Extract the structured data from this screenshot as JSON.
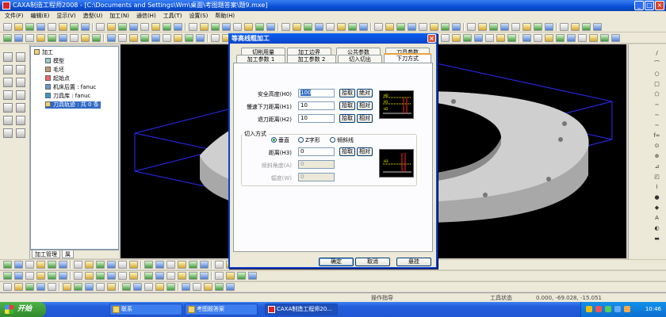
{
  "window": {
    "title": "CAXA制造工程师2008  - [C:\\Documents and Settings\\Wm\\桌面\\考图题答案\\题9.mxe]"
  },
  "menu": [
    "文件(F)",
    "编辑(E)",
    "显示(V)",
    "造型(U)",
    "加工(N)",
    "通信(H)",
    "工具(T)",
    "设置(S)",
    "帮助(H)"
  ],
  "tree": {
    "items": [
      {
        "label": "加工",
        "level": 0
      },
      {
        "label": "模型",
        "level": 1
      },
      {
        "label": "毛坯",
        "level": 1
      },
      {
        "label": "起始点",
        "level": 1
      },
      {
        "label": "机床后置 : fanuc",
        "level": 1
      },
      {
        "label": "刀具库 : fanuc",
        "level": 1
      },
      {
        "label": "刀具轨迹 : 共 0 条",
        "level": 1,
        "selected": true
      }
    ],
    "tabs": [
      "加工管理",
      "属"
    ]
  },
  "dialog": {
    "title": "等高线粗加工",
    "tabs_row1": [
      "切削用量",
      "加工边界",
      "公共参数",
      "刀具参数"
    ],
    "tabs_row2": [
      "加工参数 1",
      "加工参数 2",
      "切入切出",
      "下刀方式"
    ],
    "active_tab": "下刀方式",
    "fields": [
      {
        "label": "安全高度(H0)",
        "value": "100",
        "pick": "拾取",
        "mode": "绝对"
      },
      {
        "label": "慢速下刀距离(H1)",
        "value": "10",
        "pick": "拾取",
        "mode": "相对"
      },
      {
        "label": "退刀距离(H2)",
        "value": "10",
        "pick": "拾取",
        "mode": "相对"
      }
    ],
    "group_title": "切入方式",
    "radios": [
      "垂直",
      "Z字形",
      "倾斜线"
    ],
    "selected_radio": "垂直",
    "distance": {
      "label": "距离(H3)",
      "value": "0",
      "pick": "拾取",
      "mode": "相对"
    },
    "angle": {
      "label": "倾斜角度(A)",
      "value": "0"
    },
    "width": {
      "label": "幅度(W)",
      "value": "0"
    },
    "preview1_labels": [
      "H0",
      "H1",
      "H2"
    ],
    "preview2_labels": [
      "H3"
    ],
    "buttons": {
      "ok": "确定",
      "cancel": "取消",
      "hang": "悬挂"
    }
  },
  "status": {
    "hint": "操作指导",
    "state": "工具状态",
    "coords": "0.000, -69.028, -15.051"
  },
  "taskbar": {
    "start": "开始",
    "tasks": [
      "联系",
      "考图题答案",
      "CAXA制造工程师20..."
    ],
    "time": "10:46"
  },
  "colors": {
    "accent": "#0a4fd8",
    "viewport": "#000000",
    "part": "#c8c8c8",
    "stock_box": "#2a2aff"
  }
}
